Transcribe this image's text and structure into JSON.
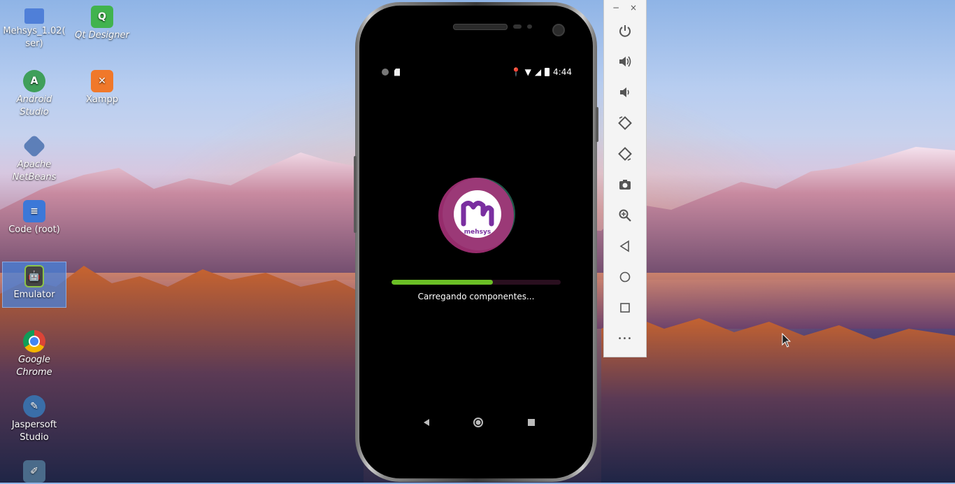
{
  "desktop": {
    "icons": [
      {
        "label": "Mehsys_1.02(\nser)",
        "icon": "folder-icon"
      },
      {
        "label": "Qt Designer",
        "icon": "qt-designer-icon"
      },
      {
        "label": "Android Studio",
        "icon": "android-studio-icon"
      },
      {
        "label": "Xampp",
        "icon": "xampp-icon"
      },
      {
        "label": "Apache NetBeans",
        "icon": "netbeans-icon"
      },
      {
        "label": "Code (root)",
        "icon": "vscode-icon"
      },
      {
        "label": "Emulator",
        "icon": "android-emulator-icon"
      },
      {
        "label": "Google Chrome",
        "icon": "chrome-icon"
      },
      {
        "label": "Jaspersoft Studio",
        "icon": "jaspersoft-icon"
      }
    ],
    "icon_labels": {
      "mehsys_line1": "Mehsys_1.02(",
      "mehsys_line2": "ser)",
      "qt_designer": "Qt Designer",
      "android_line1": "Android",
      "android_line2": "Studio",
      "xampp": "Xampp",
      "netbeans_line1": "Apache",
      "netbeans_line2": "NetBeans",
      "code_root": "Code (root)",
      "emulator": "Emulator",
      "chrome_line1": "Google",
      "chrome_line2": "Chrome",
      "jasper_line1": "Jaspersoft",
      "jasper_line2": "Studio"
    }
  },
  "phone": {
    "status_time": "4:44",
    "app_brand": "mehsys",
    "logo_letter": "m",
    "loading_text": "Carregando componentes...",
    "progress_fraction": 0.6,
    "colors": {
      "progress_fill": "#6bbf26",
      "logo_ring": "#b0347f",
      "logo_letter": "#7a2fa0"
    }
  },
  "emulator_toolbar": {
    "window_buttons": [
      "minimize-icon",
      "close-icon"
    ],
    "minimize_glyph": "−",
    "close_glyph": "×",
    "tools": [
      "power-icon",
      "volume-up-icon",
      "volume-down-icon",
      "rotate-left-icon",
      "rotate-right-icon",
      "screenshot-camera-icon",
      "zoom-icon",
      "back-icon",
      "home-icon",
      "overview-icon",
      "more-icon"
    ],
    "more_glyph": "•••"
  }
}
